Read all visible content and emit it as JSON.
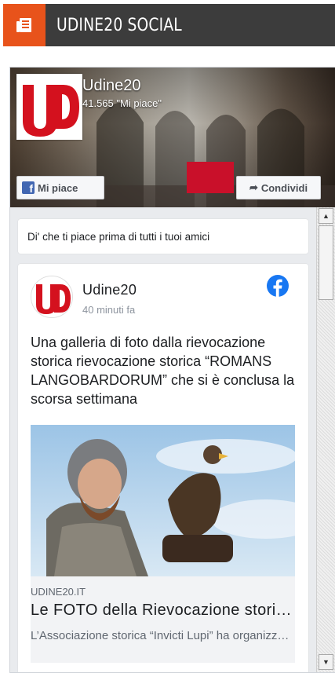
{
  "widget": {
    "title": "UDINE20 SOCIAL",
    "icon": "newspaper-icon",
    "accent_color": "#e8531b"
  },
  "facebook": {
    "page_name": "Udine20",
    "likes_text": "41.565 \"Mi piace\"",
    "like_button": "Mi piace",
    "share_button": "Condividi",
    "friends_prompt": "Di' che ti piace prima di tutti i tuoi amici",
    "post": {
      "author": "Udine20",
      "time": "40 minuti fa",
      "text": "Una galleria di foto dalla rievocazione storica rievocazione storica “ROMANS LANGOBARDORUM” che si è conclusa la scorsa settimana",
      "link": {
        "domain": "UDINE20.IT",
        "title": "Le FOTO della Rievocazione storica \"Romans Langobardorum\"",
        "description": "L’Associazione storica “Invicti Lupi” ha organizzato la rievocazione"
      }
    },
    "brand_color": "#1877f2"
  }
}
